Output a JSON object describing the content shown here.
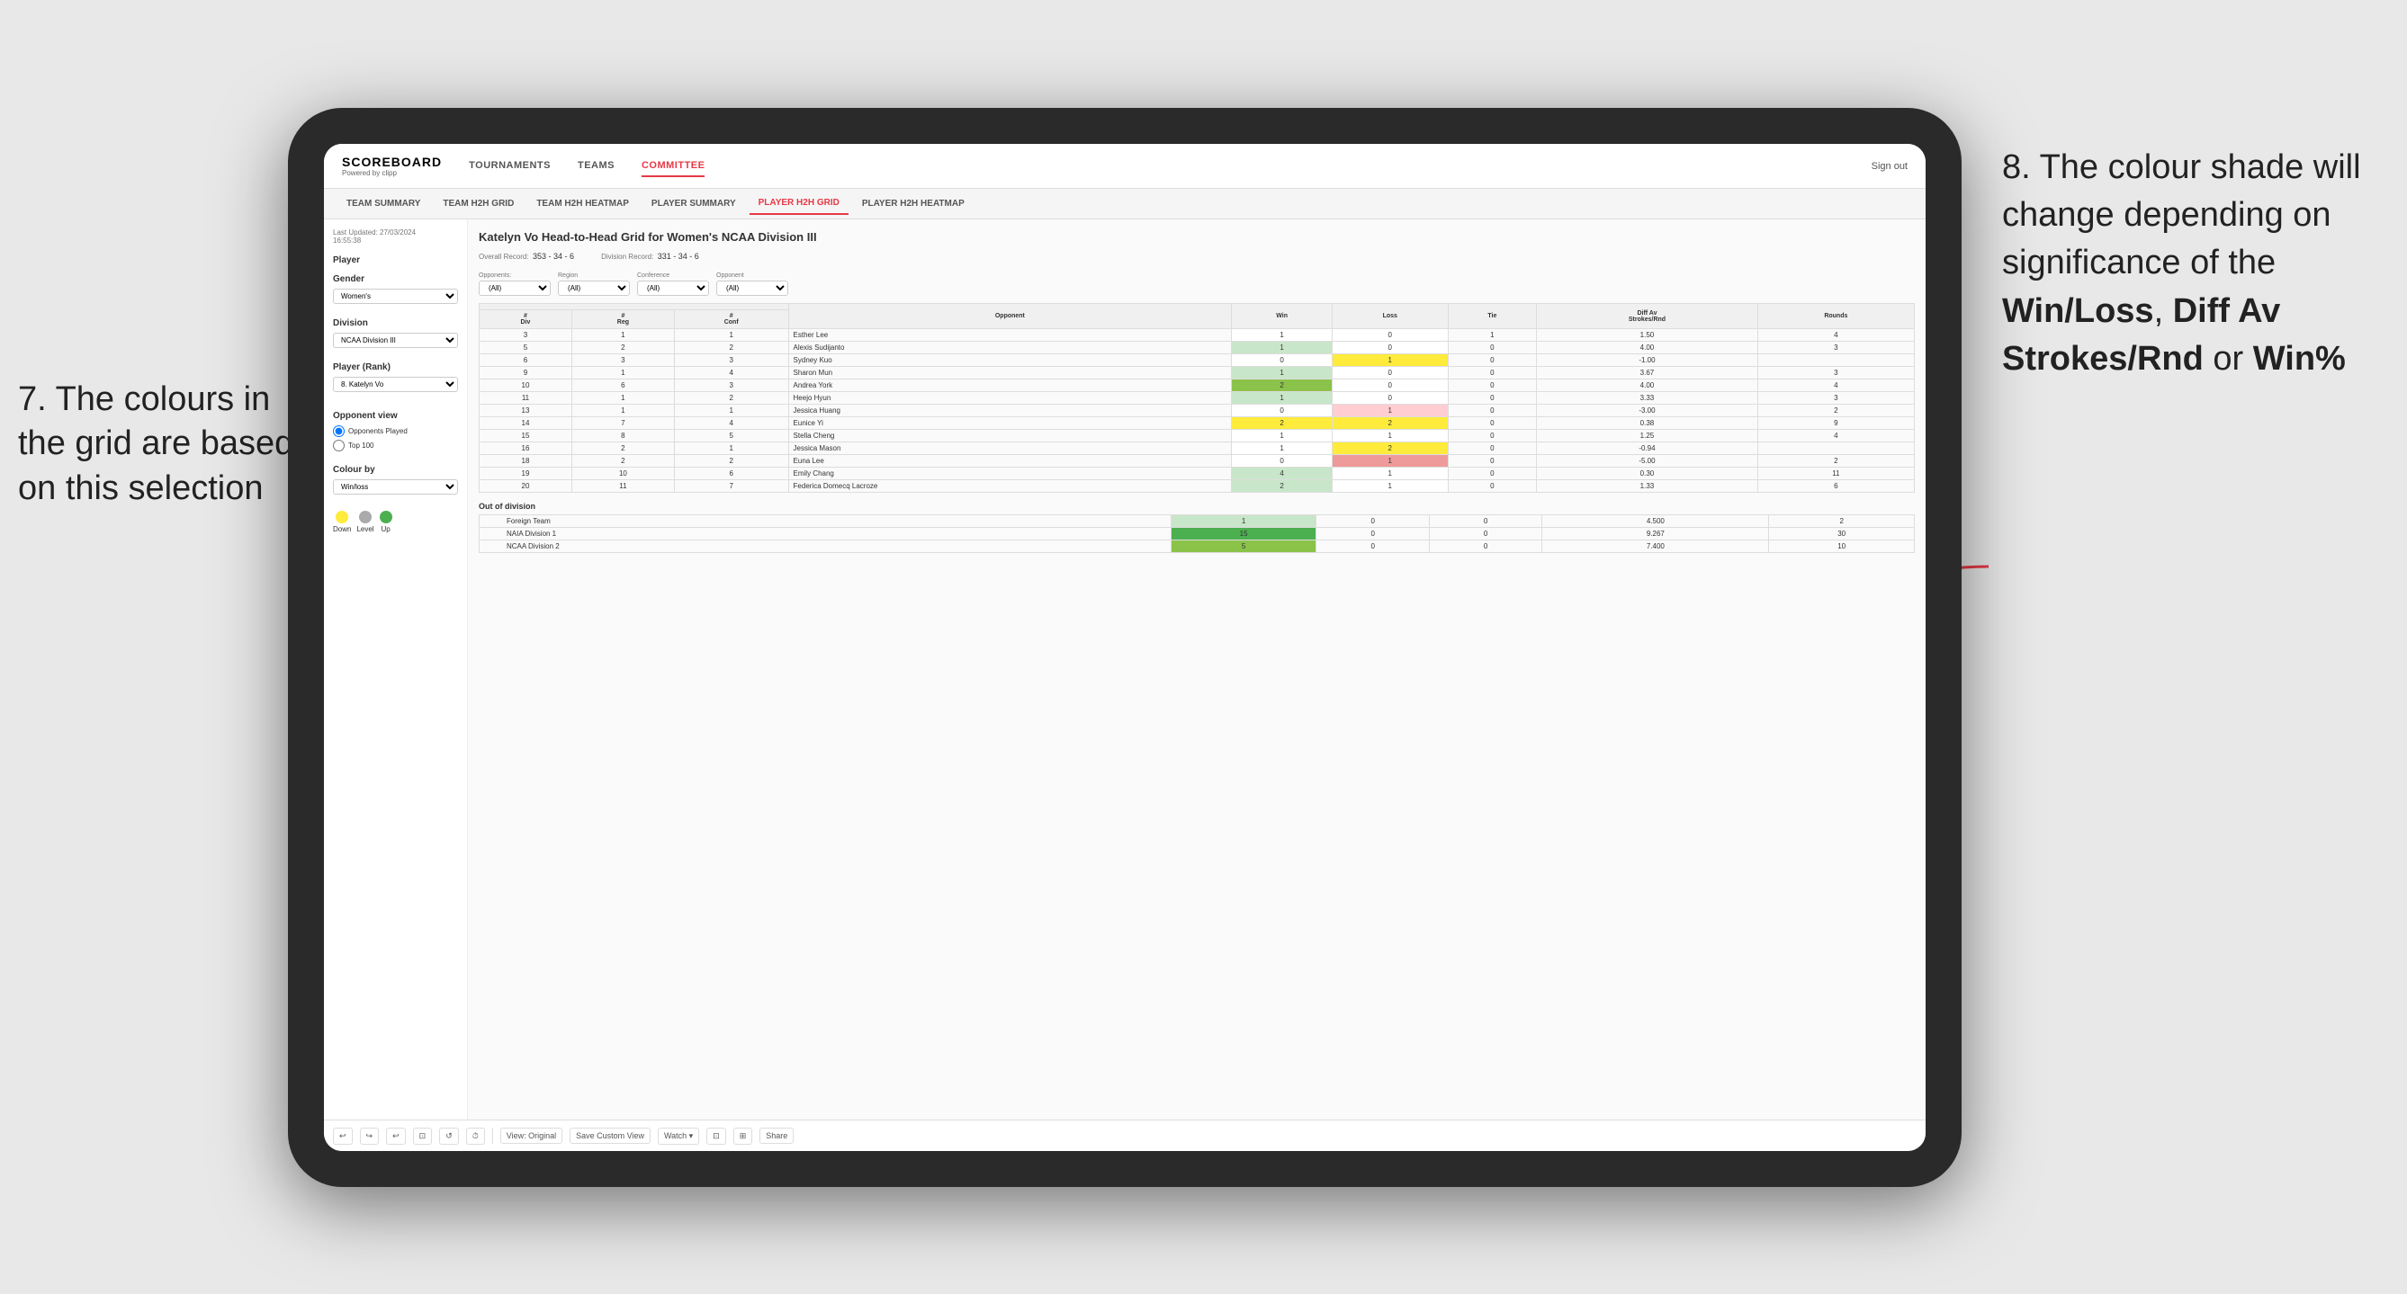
{
  "annotation_left": {
    "number": "7.",
    "text": "The colours in the grid are based on this selection"
  },
  "annotation_right": {
    "number": "8.",
    "intro": "The colour shade will change depending on significance of the ",
    "bold1": "Win/Loss",
    "sep1": ", ",
    "bold2": "Diff Av Strokes/Rnd",
    "sep2": " or ",
    "bold3": "Win%"
  },
  "nav": {
    "logo": "SCOREBOARD",
    "logo_sub": "Powered by clipp",
    "items": [
      "TOURNAMENTS",
      "TEAMS",
      "COMMITTEE"
    ],
    "active": "COMMITTEE",
    "sign_out": "Sign out"
  },
  "sub_nav": {
    "items": [
      "TEAM SUMMARY",
      "TEAM H2H GRID",
      "TEAM H2H HEATMAP",
      "PLAYER SUMMARY",
      "PLAYER H2H GRID",
      "PLAYER H2H HEATMAP"
    ],
    "active": "PLAYER H2H GRID"
  },
  "left_panel": {
    "last_updated_label": "Last Updated: 27/03/2024",
    "last_updated_time": "16:55:38",
    "player_label": "Player",
    "gender_label": "Gender",
    "gender_value": "Women's",
    "division_label": "Division",
    "division_value": "NCAA Division III",
    "player_rank_label": "Player (Rank)",
    "player_rank_value": "8. Katelyn Vo",
    "opponent_view_label": "Opponent view",
    "radio1": "Opponents Played",
    "radio2": "Top 100",
    "colour_by_label": "Colour by",
    "colour_by_value": "Win/loss",
    "legend_down": "Down",
    "legend_level": "Level",
    "legend_up": "Up"
  },
  "grid": {
    "title": "Katelyn Vo Head-to-Head Grid for Women's NCAA Division III",
    "overall_record_label": "Overall Record:",
    "overall_record": "353 - 34 - 6",
    "division_record_label": "Division Record:",
    "division_record": "331 - 34 - 6",
    "filter_opponents_label": "Opponents:",
    "filter_region_label": "Region",
    "filter_conference_label": "Conference",
    "filter_opponent_label": "Opponent",
    "filter_opponents_val": "(All)",
    "filter_region_val": "(All)",
    "filter_conference_val": "(All)",
    "col_headers": [
      "#\nDiv",
      "#\nReg",
      "#\nConf",
      "Opponent",
      "Win",
      "Loss",
      "Tie",
      "Diff Av\nStrokes/Rnd",
      "Rounds"
    ],
    "rows": [
      {
        "div": "3",
        "reg": "1",
        "conf": "1",
        "opponent": "Esther Lee",
        "win": 1,
        "loss": 0,
        "tie": 1,
        "diff": "1.50",
        "rounds": "4",
        "win_color": "white",
        "loss_color": "white"
      },
      {
        "div": "5",
        "reg": "2",
        "conf": "2",
        "opponent": "Alexis Sudijanto",
        "win": 1,
        "loss": 0,
        "tie": 0,
        "diff": "4.00",
        "rounds": "3",
        "win_color": "green_light",
        "loss_color": "white"
      },
      {
        "div": "6",
        "reg": "3",
        "conf": "3",
        "opponent": "Sydney Kuo",
        "win": 0,
        "loss": 1,
        "tie": 0,
        "diff": "-1.00",
        "rounds": "",
        "win_color": "white",
        "loss_color": "yellow"
      },
      {
        "div": "9",
        "reg": "1",
        "conf": "4",
        "opponent": "Sharon Mun",
        "win": 1,
        "loss": 0,
        "tie": 0,
        "diff": "3.67",
        "rounds": "3",
        "win_color": "green_light",
        "loss_color": "white"
      },
      {
        "div": "10",
        "reg": "6",
        "conf": "3",
        "opponent": "Andrea York",
        "win": 2,
        "loss": 0,
        "tie": 0,
        "diff": "4.00",
        "rounds": "4",
        "win_color": "green_med",
        "loss_color": "white"
      },
      {
        "div": "11",
        "reg": "1",
        "conf": "2",
        "opponent": "Heejo Hyun",
        "win": 1,
        "loss": 0,
        "tie": 0,
        "diff": "3.33",
        "rounds": "3",
        "win_color": "green_light",
        "loss_color": "white"
      },
      {
        "div": "13",
        "reg": "1",
        "conf": "1",
        "opponent": "Jessica Huang",
        "win": 0,
        "loss": 1,
        "tie": 0,
        "diff": "-3.00",
        "rounds": "2",
        "win_color": "white",
        "loss_color": "red_light"
      },
      {
        "div": "14",
        "reg": "7",
        "conf": "4",
        "opponent": "Eunice Yi",
        "win": 2,
        "loss": 2,
        "tie": 0,
        "diff": "0.38",
        "rounds": "9",
        "win_color": "yellow",
        "loss_color": "yellow"
      },
      {
        "div": "15",
        "reg": "8",
        "conf": "5",
        "opponent": "Stella Cheng",
        "win": 1,
        "loss": 1,
        "tie": 0,
        "diff": "1.25",
        "rounds": "4",
        "win_color": "white",
        "loss_color": "white"
      },
      {
        "div": "16",
        "reg": "2",
        "conf": "1",
        "opponent": "Jessica Mason",
        "win": 1,
        "loss": 2,
        "tie": 0,
        "diff": "-0.94",
        "rounds": "",
        "win_color": "white",
        "loss_color": "yellow"
      },
      {
        "div": "18",
        "reg": "2",
        "conf": "2",
        "opponent": "Euna Lee",
        "win": 0,
        "loss": 1,
        "tie": 0,
        "diff": "-5.00",
        "rounds": "2",
        "win_color": "white",
        "loss_color": "red_med"
      },
      {
        "div": "19",
        "reg": "10",
        "conf": "6",
        "opponent": "Emily Chang",
        "win": 4,
        "loss": 1,
        "tie": 0,
        "diff": "0.30",
        "rounds": "11",
        "win_color": "green_light",
        "loss_color": "white"
      },
      {
        "div": "20",
        "reg": "11",
        "conf": "7",
        "opponent": "Federica Domecq Lacroze",
        "win": 2,
        "loss": 1,
        "tie": 0,
        "diff": "1.33",
        "rounds": "6",
        "win_color": "green_light",
        "loss_color": "white"
      }
    ],
    "out_of_division_label": "Out of division",
    "ood_rows": [
      {
        "opponent": "Foreign Team",
        "win": 1,
        "loss": 0,
        "tie": 0,
        "diff": "4.500",
        "rounds": "2",
        "win_color": "green_light"
      },
      {
        "opponent": "NAIA Division 1",
        "win": 15,
        "loss": 0,
        "tie": 0,
        "diff": "9.267",
        "rounds": "30",
        "win_color": "green_dark"
      },
      {
        "opponent": "NCAA Division 2",
        "win": 5,
        "loss": 0,
        "tie": 0,
        "diff": "7.400",
        "rounds": "10",
        "win_color": "green_med"
      }
    ]
  },
  "toolbar": {
    "buttons": [
      "↩",
      "↪",
      "↩",
      "⊡",
      "↺",
      "⏱",
      "|",
      "View: Original",
      "Save Custom View",
      "Watch ▾",
      "⊡",
      "⊞",
      "Share"
    ]
  }
}
